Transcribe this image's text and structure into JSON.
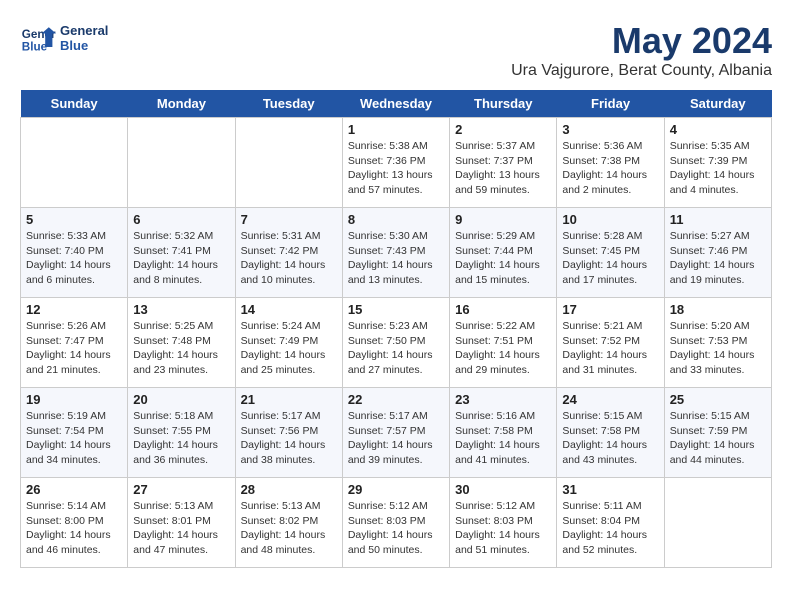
{
  "header": {
    "logo_line1": "General",
    "logo_line2": "Blue",
    "month_title": "May 2024",
    "location": "Ura Vajgurore, Berat County, Albania"
  },
  "weekdays": [
    "Sunday",
    "Monday",
    "Tuesday",
    "Wednesday",
    "Thursday",
    "Friday",
    "Saturday"
  ],
  "weeks": [
    [
      {
        "day": "",
        "info": ""
      },
      {
        "day": "",
        "info": ""
      },
      {
        "day": "",
        "info": ""
      },
      {
        "day": "1",
        "info": "Sunrise: 5:38 AM\nSunset: 7:36 PM\nDaylight: 13 hours and 57 minutes."
      },
      {
        "day": "2",
        "info": "Sunrise: 5:37 AM\nSunset: 7:37 PM\nDaylight: 13 hours and 59 minutes."
      },
      {
        "day": "3",
        "info": "Sunrise: 5:36 AM\nSunset: 7:38 PM\nDaylight: 14 hours and 2 minutes."
      },
      {
        "day": "4",
        "info": "Sunrise: 5:35 AM\nSunset: 7:39 PM\nDaylight: 14 hours and 4 minutes."
      }
    ],
    [
      {
        "day": "5",
        "info": "Sunrise: 5:33 AM\nSunset: 7:40 PM\nDaylight: 14 hours and 6 minutes."
      },
      {
        "day": "6",
        "info": "Sunrise: 5:32 AM\nSunset: 7:41 PM\nDaylight: 14 hours and 8 minutes."
      },
      {
        "day": "7",
        "info": "Sunrise: 5:31 AM\nSunset: 7:42 PM\nDaylight: 14 hours and 10 minutes."
      },
      {
        "day": "8",
        "info": "Sunrise: 5:30 AM\nSunset: 7:43 PM\nDaylight: 14 hours and 13 minutes."
      },
      {
        "day": "9",
        "info": "Sunrise: 5:29 AM\nSunset: 7:44 PM\nDaylight: 14 hours and 15 minutes."
      },
      {
        "day": "10",
        "info": "Sunrise: 5:28 AM\nSunset: 7:45 PM\nDaylight: 14 hours and 17 minutes."
      },
      {
        "day": "11",
        "info": "Sunrise: 5:27 AM\nSunset: 7:46 PM\nDaylight: 14 hours and 19 minutes."
      }
    ],
    [
      {
        "day": "12",
        "info": "Sunrise: 5:26 AM\nSunset: 7:47 PM\nDaylight: 14 hours and 21 minutes."
      },
      {
        "day": "13",
        "info": "Sunrise: 5:25 AM\nSunset: 7:48 PM\nDaylight: 14 hours and 23 minutes."
      },
      {
        "day": "14",
        "info": "Sunrise: 5:24 AM\nSunset: 7:49 PM\nDaylight: 14 hours and 25 minutes."
      },
      {
        "day": "15",
        "info": "Sunrise: 5:23 AM\nSunset: 7:50 PM\nDaylight: 14 hours and 27 minutes."
      },
      {
        "day": "16",
        "info": "Sunrise: 5:22 AM\nSunset: 7:51 PM\nDaylight: 14 hours and 29 minutes."
      },
      {
        "day": "17",
        "info": "Sunrise: 5:21 AM\nSunset: 7:52 PM\nDaylight: 14 hours and 31 minutes."
      },
      {
        "day": "18",
        "info": "Sunrise: 5:20 AM\nSunset: 7:53 PM\nDaylight: 14 hours and 33 minutes."
      }
    ],
    [
      {
        "day": "19",
        "info": "Sunrise: 5:19 AM\nSunset: 7:54 PM\nDaylight: 14 hours and 34 minutes."
      },
      {
        "day": "20",
        "info": "Sunrise: 5:18 AM\nSunset: 7:55 PM\nDaylight: 14 hours and 36 minutes."
      },
      {
        "day": "21",
        "info": "Sunrise: 5:17 AM\nSunset: 7:56 PM\nDaylight: 14 hours and 38 minutes."
      },
      {
        "day": "22",
        "info": "Sunrise: 5:17 AM\nSunset: 7:57 PM\nDaylight: 14 hours and 39 minutes."
      },
      {
        "day": "23",
        "info": "Sunrise: 5:16 AM\nSunset: 7:58 PM\nDaylight: 14 hours and 41 minutes."
      },
      {
        "day": "24",
        "info": "Sunrise: 5:15 AM\nSunset: 7:58 PM\nDaylight: 14 hours and 43 minutes."
      },
      {
        "day": "25",
        "info": "Sunrise: 5:15 AM\nSunset: 7:59 PM\nDaylight: 14 hours and 44 minutes."
      }
    ],
    [
      {
        "day": "26",
        "info": "Sunrise: 5:14 AM\nSunset: 8:00 PM\nDaylight: 14 hours and 46 minutes."
      },
      {
        "day": "27",
        "info": "Sunrise: 5:13 AM\nSunset: 8:01 PM\nDaylight: 14 hours and 47 minutes."
      },
      {
        "day": "28",
        "info": "Sunrise: 5:13 AM\nSunset: 8:02 PM\nDaylight: 14 hours and 48 minutes."
      },
      {
        "day": "29",
        "info": "Sunrise: 5:12 AM\nSunset: 8:03 PM\nDaylight: 14 hours and 50 minutes."
      },
      {
        "day": "30",
        "info": "Sunrise: 5:12 AM\nSunset: 8:03 PM\nDaylight: 14 hours and 51 minutes."
      },
      {
        "day": "31",
        "info": "Sunrise: 5:11 AM\nSunset: 8:04 PM\nDaylight: 14 hours and 52 minutes."
      },
      {
        "day": "",
        "info": ""
      }
    ]
  ]
}
